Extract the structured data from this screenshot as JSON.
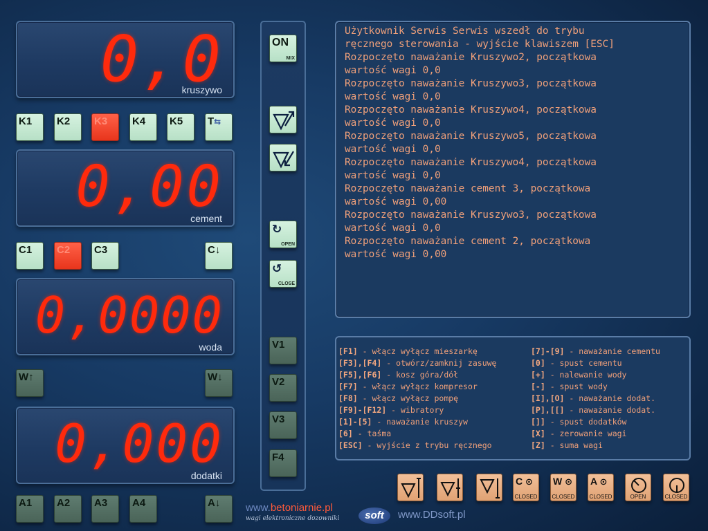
{
  "displays": {
    "kruszywo": {
      "value": "0,0",
      "label": "kruszywo"
    },
    "cement": {
      "value": "0,00",
      "label": "cement"
    },
    "woda": {
      "value": "0,0000",
      "label": "woda"
    },
    "dodatki": {
      "value": "0,000",
      "label": "dodatki"
    }
  },
  "aggregate_buttons": [
    "K1",
    "K2",
    "K3",
    "K4",
    "K5",
    "T"
  ],
  "aggregate_active": "K3",
  "cement_buttons": [
    "C1",
    "C2",
    "C3",
    "C↓"
  ],
  "cement_active": "C2",
  "water_buttons": [
    "W↑",
    "W↓"
  ],
  "additive_buttons": [
    "A1",
    "A2",
    "A3",
    "A4",
    "A↓"
  ],
  "center": {
    "on_label": "ON",
    "on_sub": "MIX",
    "open_sub": "OPEN",
    "close_sub": "CLOSE",
    "vibrators": [
      "V1",
      "V2",
      "V3"
    ],
    "f4_label": "F4"
  },
  "log_lines": [
    "Użytkownik Serwis Serwis wszedł do trybu",
    "ręcznego sterowania - wyjście klawiszem [ESC]",
    "Rozpoczęto naważanie Kruszywo2, początkowa",
    "wartość wagi 0,0",
    "Rozpoczęto naważanie Kruszywo3, początkowa",
    "wartość wagi 0,0",
    "Rozpoczęto naważanie Kruszywo4, początkowa",
    "wartość wagi 0,0",
    "Rozpoczęto naważanie Kruszywo5, początkowa",
    "wartość wagi 0,0",
    "Rozpoczęto naważanie Kruszywo4, początkowa",
    "wartość wagi 0,0",
    "Rozpoczęto naważanie cement 3, początkowa",
    "wartość wagi 0,00",
    "Rozpoczęto naważanie Kruszywo3, początkowa",
    "wartość wagi 0,0",
    "Rozpoczęto naważanie cement 2, początkowa",
    "wartość wagi 0,00"
  ],
  "help_left": [
    {
      "key": "[F1]",
      "desc": " - włącz wyłącz mieszarkę"
    },
    {
      "key": "[F3],[F4]",
      "desc": " - otwórz/zamknij zasuwę"
    },
    {
      "key": "[F5],[F6]",
      "desc": " - kosz góra/dół"
    },
    {
      "key": "[F7]",
      "desc": " - włącz wyłącz kompresor"
    },
    {
      "key": "[F8]",
      "desc": " - włącz wyłącz pompę"
    },
    {
      "key": "[F9]-[F12]",
      "desc": " - wibratory"
    },
    {
      "key": "[1]-[5]",
      "desc": " - naważanie kruszyw"
    },
    {
      "key": "[6]",
      "desc": " - taśma"
    },
    {
      "key": "[ESC]",
      "desc": " - wyjście z trybu ręcznego"
    }
  ],
  "help_right": [
    {
      "key": "[7]-[9]",
      "desc": " - naważanie cementu"
    },
    {
      "key": "[0]",
      "desc": " - spust cementu"
    },
    {
      "key": "[+]",
      "desc": " - nalewanie wody"
    },
    {
      "key": "[-]",
      "desc": " - spust wody"
    },
    {
      "key": "[I],[O]",
      "desc": " - naważanie dodat."
    },
    {
      "key": "[P],[[]",
      "desc": " - naważanie dodat."
    },
    {
      "key": "[]]",
      "desc": " - spust dodatków"
    },
    {
      "key": "[X]",
      "desc": " - zerowanie wagi"
    },
    {
      "key": "[Z]",
      "desc": " - suma wagi"
    }
  ],
  "bottom_buttons": {
    "c_label": "C",
    "w_label": "W",
    "a_label": "A",
    "closed_sub": "CLOSED",
    "open_sub": "OPEN"
  },
  "branding": {
    "www": "www.",
    "betoniarnie": "betoniarnie.pl",
    "tagline": "wagi elektroniczne dozowniki",
    "soft": "soft",
    "ddsoft": "www.DDsoft.pl"
  },
  "colors": {
    "accent_red": "#ff2a0c",
    "button_green": "#c6ead3",
    "button_dark": "#55705f",
    "tan": "#e8ae84",
    "log_text": "#f0a07a"
  }
}
